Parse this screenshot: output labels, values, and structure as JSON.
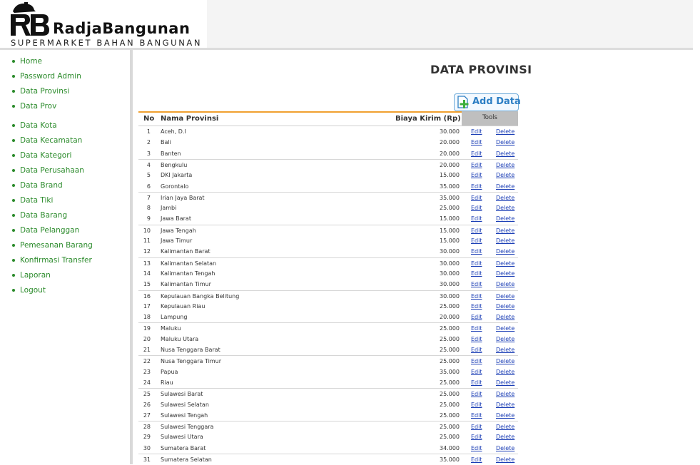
{
  "brand": {
    "name": "RadjaBangunan",
    "tagline": "SUPERMARKET BAHAN BANGUNAN",
    "logo_icon": "rb-logo-icon"
  },
  "sidebar": {
    "items": [
      {
        "label": "Home"
      },
      {
        "label": "Password Admin"
      },
      {
        "label": "Data Provinsi"
      },
      {
        "label": "Data Prov"
      },
      {
        "label": "Data Kota"
      },
      {
        "label": "Data Kecamatan"
      },
      {
        "label": "Data Kategori"
      },
      {
        "label": "Data Perusahaan"
      },
      {
        "label": "Data Brand"
      },
      {
        "label": "Data Tiki"
      },
      {
        "label": "Data Barang"
      },
      {
        "label": "Data Pelanggan"
      },
      {
        "label": "Pemesanan Barang"
      },
      {
        "label": "Konfirmasi Transfer"
      },
      {
        "label": "Laporan"
      },
      {
        "label": "Logout"
      }
    ]
  },
  "main": {
    "title": "DATA PROVINSI",
    "add_button_label": "Add Data",
    "table": {
      "headers": {
        "no": "No",
        "name": "Nama Provinsi",
        "cost": "Biaya Kirim (Rp)",
        "tools": "Tools"
      },
      "edit_label": "Edit",
      "delete_label": "Delete",
      "rows": [
        {
          "no": "1",
          "name": "Aceh, D.I",
          "cost": "30.000"
        },
        {
          "no": "2",
          "name": "Bali",
          "cost": "20.000"
        },
        {
          "no": "3",
          "name": "Banten",
          "cost": "20.000"
        },
        {
          "no": "4",
          "name": "Bengkulu",
          "cost": "20.000"
        },
        {
          "no": "5",
          "name": "DKI Jakarta",
          "cost": "15.000"
        },
        {
          "no": "6",
          "name": "Gorontalo",
          "cost": "35.000"
        },
        {
          "no": "7",
          "name": "Irian Jaya Barat",
          "cost": "35.000"
        },
        {
          "no": "8",
          "name": "Jambi",
          "cost": "25.000"
        },
        {
          "no": "9",
          "name": "Jawa Barat",
          "cost": "15.000"
        },
        {
          "no": "10",
          "name": "Jawa Tengah",
          "cost": "15.000"
        },
        {
          "no": "11",
          "name": "Jawa Timur",
          "cost": "15.000"
        },
        {
          "no": "12",
          "name": "Kalimantan Barat",
          "cost": "30.000"
        },
        {
          "no": "13",
          "name": "Kalimantan Selatan",
          "cost": "30.000"
        },
        {
          "no": "14",
          "name": "Kalimantan Tengah",
          "cost": "30.000"
        },
        {
          "no": "15",
          "name": "Kalimantan Timur",
          "cost": "30.000"
        },
        {
          "no": "16",
          "name": "Kepulauan Bangka Belitung",
          "cost": "30.000"
        },
        {
          "no": "17",
          "name": "Kepulauan Riau",
          "cost": "25.000"
        },
        {
          "no": "18",
          "name": "Lampung",
          "cost": "20.000"
        },
        {
          "no": "19",
          "name": "Maluku",
          "cost": "25.000"
        },
        {
          "no": "20",
          "name": "Maluku Utara",
          "cost": "25.000"
        },
        {
          "no": "21",
          "name": "Nusa Tenggara Barat",
          "cost": "25.000"
        },
        {
          "no": "22",
          "name": "Nusa Tenggara Timur",
          "cost": "25.000"
        },
        {
          "no": "23",
          "name": "Papua",
          "cost": "35.000"
        },
        {
          "no": "24",
          "name": "Riau",
          "cost": "25.000"
        },
        {
          "no": "25",
          "name": "Sulawesi Barat",
          "cost": "25.000"
        },
        {
          "no": "26",
          "name": "Sulawesi Selatan",
          "cost": "25.000"
        },
        {
          "no": "27",
          "name": "Sulawesi Tengah",
          "cost": "25.000"
        },
        {
          "no": "28",
          "name": "Sulawesi Tenggara",
          "cost": "25.000"
        },
        {
          "no": "29",
          "name": "Sulawesi Utara",
          "cost": "25.000"
        },
        {
          "no": "30",
          "name": "Sumatera Barat",
          "cost": "34.000"
        },
        {
          "no": "31",
          "name": "Sumatera Selatan",
          "cost": "35.000"
        }
      ]
    }
  },
  "colors": {
    "menu_link": "#2a8a2a",
    "table_link": "#1a3db5",
    "header_accent": "#f0a030",
    "tools_header_bg": "#bfbfbf",
    "add_button": "#2e7fc4"
  }
}
